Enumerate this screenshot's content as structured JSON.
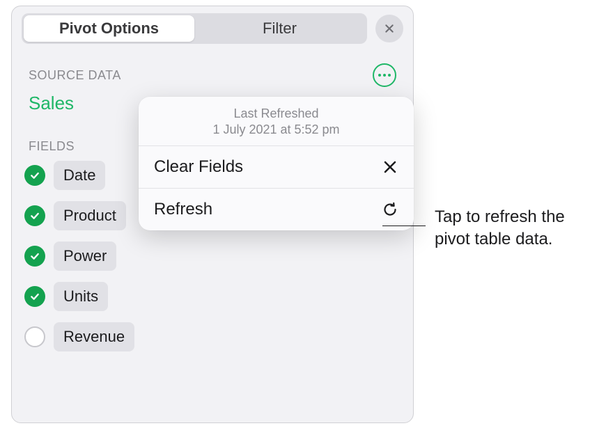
{
  "tabs": {
    "pivot": "Pivot Options",
    "filter": "Filter"
  },
  "source": {
    "label": "SOURCE DATA",
    "name": "Sales"
  },
  "fieldsLabel": "FIELDS",
  "fields": [
    {
      "label": "Date",
      "checked": true
    },
    {
      "label": "Product",
      "checked": true
    },
    {
      "label": "Power",
      "checked": true
    },
    {
      "label": "Units",
      "checked": true
    },
    {
      "label": "Revenue",
      "checked": false
    }
  ],
  "popover": {
    "headTitle": "Last Refreshed",
    "headSub": "1 July 2021  at 5:52 pm",
    "clear": "Clear Fields",
    "refresh": "Refresh"
  },
  "callout": "Tap to refresh the pivot table data."
}
